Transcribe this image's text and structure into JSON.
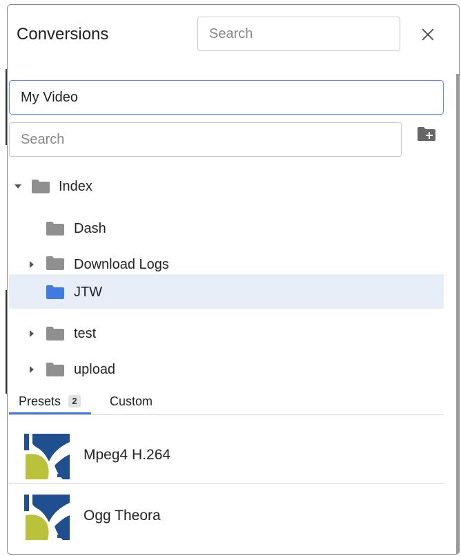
{
  "header": {
    "title": "Conversions",
    "search_placeholder": "Search"
  },
  "name_field": {
    "value": "My Video"
  },
  "tree": {
    "search_placeholder": "Search",
    "items": [
      {
        "label": "Index",
        "expanded": true,
        "has_children": true,
        "selected": false
      },
      {
        "label": "Dash",
        "expanded": false,
        "has_children": false,
        "selected": false
      },
      {
        "label": "Download Logs",
        "expanded": false,
        "has_children": true,
        "selected": false
      },
      {
        "label": "JTW",
        "expanded": false,
        "has_children": false,
        "selected": true
      },
      {
        "label": "test",
        "expanded": false,
        "has_children": true,
        "selected": false
      },
      {
        "label": "upload",
        "expanded": false,
        "has_children": true,
        "selected": false
      }
    ]
  },
  "tabs": {
    "presets": {
      "label": "Presets",
      "count": "2"
    },
    "custom": {
      "label": "Custom"
    }
  },
  "presets": [
    {
      "label": "Mpeg4 H.264",
      "icon": "preset-logo-icon"
    },
    {
      "label": "Ogg Theora",
      "icon": "preset-logo-icon"
    }
  ],
  "colors": {
    "accent": "#3f7be0",
    "selected_row": "#e8eef8",
    "folder_gray": "#8f8f8f",
    "folder_blue": "#3f7be0",
    "logo_blue": "#1f4f8f",
    "logo_green": "#b9c23a"
  }
}
